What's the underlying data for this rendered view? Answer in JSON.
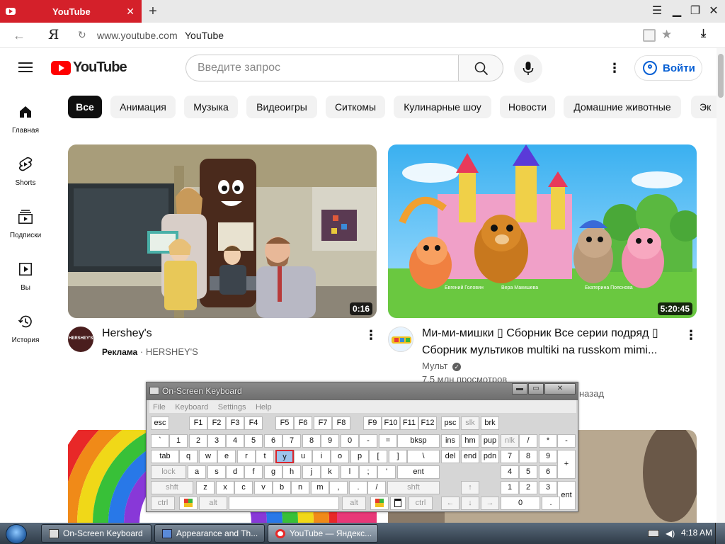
{
  "browser": {
    "tab_title": "YouTube",
    "url": "www.youtube.com",
    "page_title": "YouTube",
    "logo_char": "Я"
  },
  "header": {
    "logo_text": "YouTube",
    "search_placeholder": "Введите запрос",
    "signin_label": "Войти"
  },
  "sidebar": {
    "items": [
      {
        "label": "Главная",
        "icon": "home-icon"
      },
      {
        "label": "Shorts",
        "icon": "shorts-icon"
      },
      {
        "label": "Подписки",
        "icon": "subscriptions-icon"
      },
      {
        "label": "Вы",
        "icon": "you-icon"
      },
      {
        "label": "История",
        "icon": "history-icon"
      }
    ]
  },
  "chips": [
    "Все",
    "Анимация",
    "Музыка",
    "Видеоигры",
    "Ситкомы",
    "Кулинарные шоу",
    "Новости",
    "Домашние животные",
    "Эк"
  ],
  "videos": [
    {
      "title": "Hershey's",
      "duration": "0:16",
      "ad_label": "Реклама",
      "channel": "HERSHEY'S",
      "avatar_text": "HERSHEY'S"
    },
    {
      "title_line1": "Ми-ми-мишки ▯ Сборник Все серии подряд ▯",
      "title_line2": "Сборник мультиков multiki na russkom mimi...",
      "duration": "5:20:45",
      "channel": "Мульт",
      "views": "7,5 млн просмотров",
      "age_fragment": "назад",
      "thumb_caption_1": "Евгений Головин",
      "thumb_caption_2": "Вера Макишева",
      "thumb_caption_3": "Екатерина Пояснова"
    }
  ],
  "osk": {
    "title": "On-Screen Keyboard",
    "menu": [
      "File",
      "Keyboard",
      "Settings",
      "Help"
    ],
    "rows": [
      [
        "esc",
        "F1",
        "F2",
        "F3",
        "F4",
        "F5",
        "F6",
        "F7",
        "F8",
        "F9",
        "F10",
        "F11",
        "F12",
        "psc",
        "slk",
        "brk"
      ],
      [
        "`",
        "1",
        "2",
        "3",
        "4",
        "5",
        "6",
        "7",
        "8",
        "9",
        "0",
        "-",
        "=",
        "bksp",
        "ins",
        "hm",
        "pup",
        "nlk",
        "/",
        "*",
        "-"
      ],
      [
        "tab",
        "q",
        "w",
        "e",
        "r",
        "t",
        "y",
        "u",
        "i",
        "o",
        "p",
        "[",
        "]",
        "\\",
        "del",
        "end",
        "pdn",
        "7",
        "8",
        "9",
        "+"
      ],
      [
        "lock",
        "a",
        "s",
        "d",
        "f",
        "g",
        "h",
        "j",
        "k",
        "l",
        ";",
        "'",
        "ent",
        "4",
        "5",
        "6"
      ],
      [
        "shft",
        "z",
        "x",
        "c",
        "v",
        "b",
        "n",
        "m",
        ",",
        ".",
        "/",
        "shft",
        "↑",
        "1",
        "2",
        "3",
        "ent"
      ],
      [
        "ctrl",
        "win",
        "alt",
        "",
        "alt",
        "win",
        "menu",
        "ctrl",
        "←",
        "↓",
        "→",
        "0",
        "."
      ]
    ],
    "highlighted_key": "y"
  },
  "taskbar": {
    "tasks": [
      "On-Screen Keyboard",
      "Appearance and Th...",
      "YouTube — Яндекс..."
    ],
    "clock": "4:18 AM"
  },
  "colors": {
    "tab_red": "#d4202a",
    "yt_red": "#ff0000",
    "link_blue": "#065fd4",
    "osk_highlight": "#9dc3ec"
  }
}
